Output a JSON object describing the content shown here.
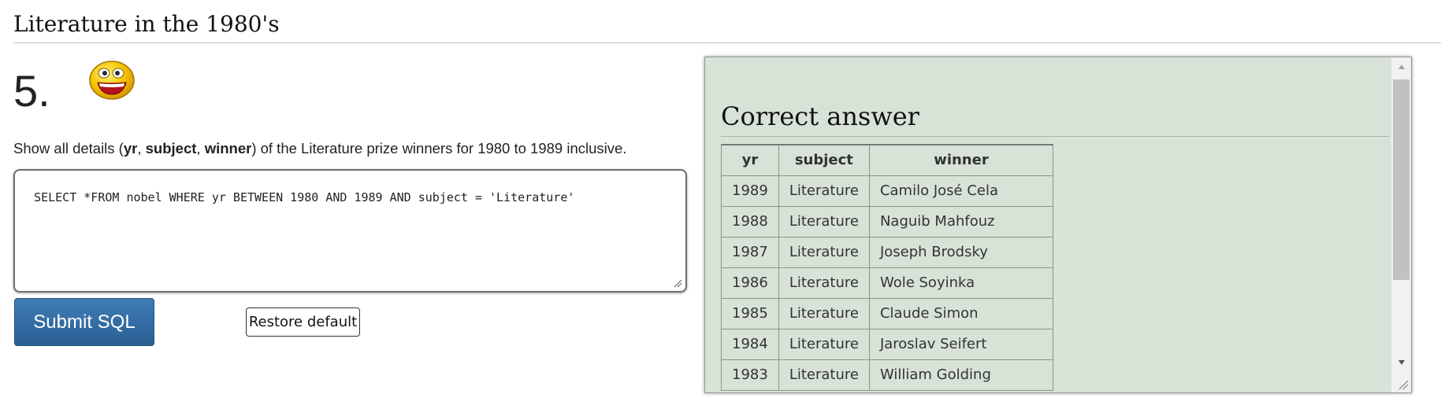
{
  "page": {
    "title": "Literature in the 1980's"
  },
  "question": {
    "number": "5.",
    "text_before": "Show all details (",
    "field_yr": "yr",
    "sep1": ", ",
    "field_subject": "subject",
    "sep2": ", ",
    "field_winner": "winner",
    "text_after": ") of the Literature prize winners for 1980 to 1989 inclusive."
  },
  "editor": {
    "sql": "SELECT *FROM nobel WHERE yr BETWEEN 1980 AND 1989 AND subject = 'Literature'"
  },
  "buttons": {
    "submit": "Submit SQL",
    "restore": "Restore default"
  },
  "answer": {
    "heading": "Correct answer",
    "columns": [
      "yr",
      "subject",
      "winner"
    ],
    "rows": [
      [
        "1989",
        "Literature",
        "Camilo José Cela"
      ],
      [
        "1988",
        "Literature",
        "Naguib Mahfouz"
      ],
      [
        "1987",
        "Literature",
        "Joseph Brodsky"
      ],
      [
        "1986",
        "Literature",
        "Wole Soyinka"
      ],
      [
        "1985",
        "Literature",
        "Claude Simon"
      ],
      [
        "1984",
        "Literature",
        "Jaroslav Seifert"
      ],
      [
        "1983",
        "Literature",
        "William Golding"
      ]
    ]
  },
  "colors": {
    "panel_bg": "#d8e3d8",
    "submit_bg": "#2f6aa3",
    "smiley_face": "#f5c400"
  },
  "icons": {
    "smiley": "smiley-face-icon",
    "scroll_up": "triangle-up-icon",
    "scroll_down": "triangle-down-icon",
    "resize": "resize-grip-icon"
  }
}
